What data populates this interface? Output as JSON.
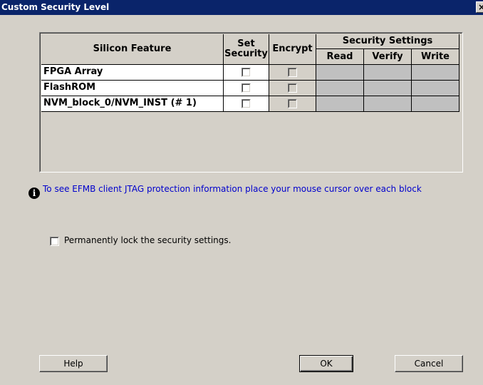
{
  "window": {
    "title": "Custom Security Level",
    "close_glyph": "×"
  },
  "table": {
    "headers": {
      "silicon_feature": "Silicon Feature",
      "set_security": "Set Security",
      "encrypt": "Encrypt",
      "security_settings": "Security Settings",
      "read": "Read",
      "verify": "Verify",
      "write": "Write"
    },
    "rows": [
      {
        "feature": "FPGA Array",
        "set_security": false,
        "encrypt": false
      },
      {
        "feature": "FlashROM",
        "set_security": false,
        "encrypt": false
      },
      {
        "feature": "NVM_block_0/NVM_INST (# 1)",
        "set_security": false,
        "encrypt": false
      }
    ]
  },
  "info": {
    "icon": "info-icon",
    "icon_glyph": "i",
    "text": "To see EFMB client JTAG protection information place your mouse cursor over each block"
  },
  "lock": {
    "label": "Permanently lock the security settings.",
    "checked": false
  },
  "buttons": {
    "help": "Help",
    "ok": "OK",
    "cancel": "Cancel"
  }
}
